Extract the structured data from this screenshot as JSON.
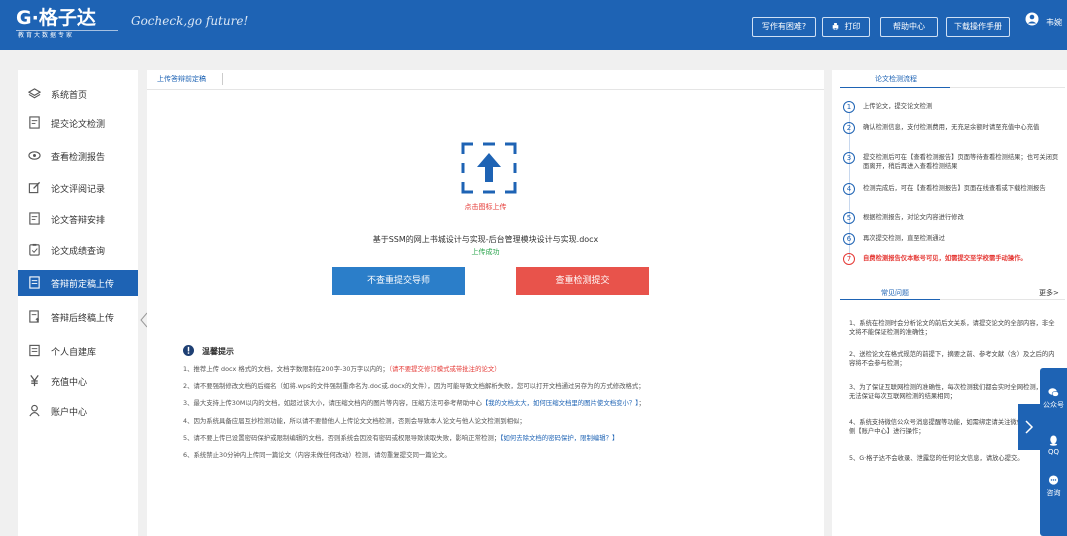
{
  "header": {
    "logo_main": "G·格子达",
    "logo_sub": "教育大数据专家",
    "slogan": "Gocheck,go future!",
    "buttons": [
      "写作有困难?",
      "打印",
      "帮助中心",
      "下载操作手册"
    ],
    "user_name": "韦婉"
  },
  "sidebar": {
    "items": [
      {
        "label": "系统首页",
        "icon": "layers-icon"
      },
      {
        "label": "提交论文检测",
        "icon": "document-icon"
      },
      {
        "label": "查看检测报告",
        "icon": "eye-icon"
      },
      {
        "label": "论文评阅记录",
        "icon": "edit-icon"
      },
      {
        "label": "论文答辩安排",
        "icon": "document-icon"
      },
      {
        "label": "论文成绩查询",
        "icon": "clipboard-icon"
      },
      {
        "label": "答辩前定稿上传",
        "icon": "upload-document-icon"
      },
      {
        "label": "答辩后终稿上传",
        "icon": "upload-document-icon"
      },
      {
        "label": "个人自建库",
        "icon": "library-icon"
      },
      {
        "label": "充值中心",
        "icon": "yen-icon"
      },
      {
        "label": "账户中心",
        "icon": "user-icon"
      }
    ],
    "active_index": 6
  },
  "main": {
    "tab_label": "上传答辩前定稿",
    "upload_hint": "点击图标上传",
    "file_name": "基于SSM的网上书城设计与实现-后台管理模块设计与实现.docx",
    "upload_status": "上传成功",
    "btn_no_check": "不查重提交导师",
    "btn_check": "查重检测提交",
    "tips_title": "温馨提示",
    "tips": [
      {
        "text": "1、推荐上传 docx 格式的文档，文档字数限制在200字-30万字以内的；",
        "red": "（请不要提交修订模式或带批注的论文）"
      },
      {
        "text": "2、请不要强制修改文档的后缀名（如将.wps的文件强制重命名为.doc或.docx的文件），因为可能导致文档解析失败，您可以打开文档通过另存为的方式修改格式；"
      },
      {
        "text": "3、最大支持上传30M以内的文档，如超过该大小，请压缩文档内的图片等内容，压缩方法可参考帮助中心",
        "blue": "【我的文档太大，如何压缩文档里的图片使文档变小？】",
        "tail": "；"
      },
      {
        "text": "4、因为系统具备应届互抄检测功能，所以请不要替他人上传论文文档检测，否则会导致本人论文与他人论文检测到相似；"
      },
      {
        "text": "5、请不要上传已设置密码保护或限制编辑的文档，否则系统会因没有密码或权限导致读取失败，影响正常检测；",
        "blue": "【如何去除文档的密码保护，限制编辑？】"
      },
      {
        "text": "6、系统禁止30分钟内上传同一篇论文（内容未做任何改动）检测，请勿重复提交同一篇论文。"
      }
    ]
  },
  "right_panel": {
    "flow_title": "论文检测流程",
    "steps": [
      {
        "num": "1",
        "text": "上传论文，提交论文检测"
      },
      {
        "num": "2",
        "text": "确认检测信息，支付检测费用，无充足余额时请至充值中心充值"
      },
      {
        "num": "3",
        "text": "提交检测后可在【查看检测报告】页面等待查看检测结果；也可关闭页面离开，稍后再进入查看检测结果"
      },
      {
        "num": "4",
        "text": "检测完成后，可在【查看检测报告】页面在线查看或下载检测报告"
      },
      {
        "num": "5",
        "text": "根据检测报告，对论文内容进行修改"
      },
      {
        "num": "6",
        "text": "再次提交检测，直至检测通过"
      },
      {
        "num": "7",
        "text": "自费检测报告仅本账号可见，如需提交至学校需手动操作。",
        "red": true
      }
    ],
    "faq_title": "常见问题",
    "faq_more": "更多>",
    "faqs": [
      "1、系统在检测时会分析论文的前后文关系，请提交论文的全部内容，非全文将不能保证检测的准确性；",
      "2、送检论文在格式规范的前提下，摘要之前、参考文献（含）及之后的内容将不会参与检测；",
      "3、为了保证互联网检测的准确性，每次检测我们都会实时全网检测，因此无法保证每次互联网检测的结果相同；",
      "4、系统支持微信公众号消息提醒等功能，如需绑定请关注微信，请点击左侧【账户中心】进行操作；",
      "5、G·格子达不会收录、泄露您的任何论文信息，请放心提交。"
    ]
  },
  "float_bar": {
    "items": [
      "公众号",
      "QQ",
      "咨询"
    ]
  },
  "colors": {
    "brand": "#1e63b4",
    "danger": "#e8534b",
    "primary_button": "#2b7ec9",
    "success": "#27a34a"
  }
}
